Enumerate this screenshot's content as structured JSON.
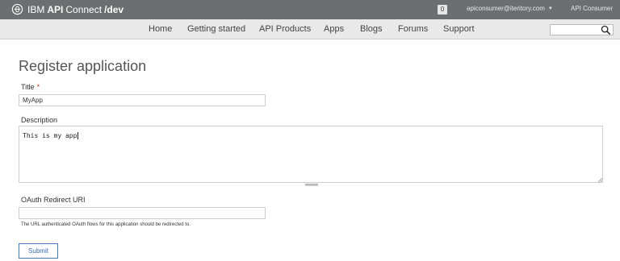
{
  "header": {
    "brand": {
      "ibm": "IBM",
      "api": "API",
      "connect": "Connect",
      "env": "/dev"
    },
    "notification_count": "0",
    "user_email": "apiconsumer@iteritory.com",
    "org_name": "API Consumer"
  },
  "nav": {
    "items": [
      {
        "label": "Home"
      },
      {
        "label": "Getting started"
      },
      {
        "label": "API Products"
      },
      {
        "label": "Apps"
      },
      {
        "label": "Blogs"
      },
      {
        "label": "Forums"
      },
      {
        "label": "Support"
      }
    ],
    "search": {
      "value": "",
      "placeholder": ""
    }
  },
  "form": {
    "heading": "Register application",
    "title_label": "Title",
    "required_mark": "*",
    "title_value": "MyApp",
    "description_label": "Description",
    "description_value": "This is my app",
    "oauth_label": "OAuth Redirect URI",
    "oauth_value": "",
    "oauth_help": "The URL authenticated OAuth flows for this application should be redirected to.",
    "submit_label": "Submit"
  },
  "colors": {
    "topbar": "#6d6e72",
    "navbar": "#e9e9e9",
    "required": "#c0392b",
    "submit_border": "#4a7fc0"
  },
  "icons": {
    "brand": "ibm-bee-logo-icon",
    "search": "search-icon",
    "user_dropdown": "chevron-down-icon"
  }
}
